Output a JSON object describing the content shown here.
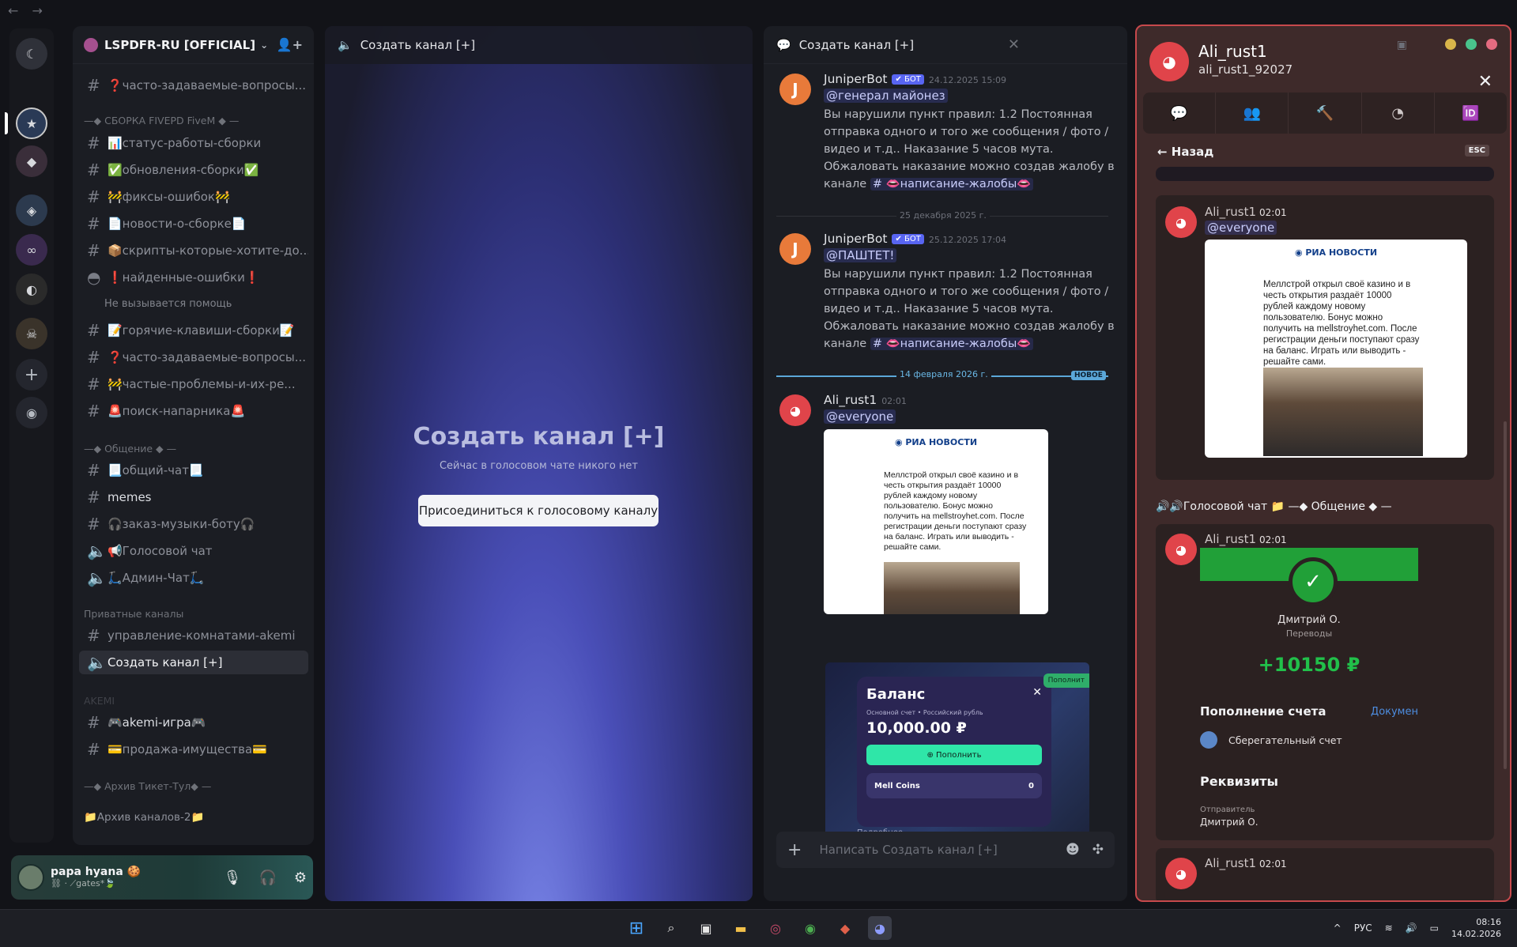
{
  "nav": {
    "back": "←",
    "forward": "→"
  },
  "guild": {
    "name": "LSPDFR-RU [OFFICIAL]",
    "channels": [
      {
        "label": "❓часто-задаваемые-вопросы..."
      },
      {
        "label": "📊статус-работы-сборки"
      },
      {
        "label": "✅обновления-сборки✅"
      },
      {
        "label": "🚧фиксы-ошибок🚧"
      },
      {
        "label": "📄новости-о-сборке📄"
      },
      {
        "label": "📦скрипты-которые-хотите-до..."
      },
      {
        "label": "❗найденные-ошибки❗"
      },
      {
        "label": "📝горячие-клавиши-сборки📝"
      },
      {
        "label": "❓часто-задаваемые-вопросы..."
      },
      {
        "label": "🚧частые-проблемы-и-их-ре..."
      },
      {
        "label": "🚨поиск-напарника🚨"
      },
      {
        "label": "📃общий-чат📃"
      },
      {
        "label": "memes"
      },
      {
        "label": "🎧заказ-музыки-боту🎧"
      },
      {
        "label": "📢Голосовой чат"
      },
      {
        "label": "🛴Админ-Чат🛴"
      },
      {
        "label": "управление-комнатами-akemi"
      },
      {
        "label": "Создать канал [+]"
      },
      {
        "label": "🎮akemi-игра🎮"
      },
      {
        "label": "💳продажа-имущества💳"
      }
    ],
    "categories": {
      "c1": "—◆ СБОРКА FIVEPD FiveM ◆ —",
      "c2": "—◆ Общение ◆ —",
      "c3": "Приватные каналы",
      "c4": "AKEMI",
      "c5": "—◆ Архив Тикет-Тул◆ —",
      "c6": "📁Архив каналов-2📁"
    },
    "thread_note": "Не вызывается помощь"
  },
  "user": {
    "name": "papa hyana 🍪",
    "status": "⛓ · ⟋gates*🍃"
  },
  "voice": {
    "header": "Создать канал [+]",
    "title": "Создать канал [+]",
    "subtitle": "Сейчас в голосовом чате никого нет",
    "join_button": "Присоединиться к голосовому каналу"
  },
  "chat": {
    "header": "Создать канал [+]",
    "messages": [
      {
        "author": "JuniperBot",
        "bot": "✔ БОТ",
        "time": "24.12.2025 15:09",
        "mention": "@генерал майонез",
        "lines": [
          "Вы нарушили пункт правил: 1.2 Постоянная",
          "отправка одного и того же сообщения / фото /",
          "видео и т.д.. Наказание 5 часов мута.",
          "Обжаловать наказание можно создав жалобу в"
        ],
        "tail": "канале",
        "link": "# 👄написание-жалобы👄"
      },
      {
        "author": "JuniperBot",
        "bot": "✔ БОТ",
        "time": "25.12.2025 17:04",
        "mention": "@ПАШТЕТ!",
        "lines": [
          "Вы нарушили пункт правил: 1.2 Постоянная",
          "отправка одного и того же сообщения / фото /",
          "видео и т.д.. Наказание 5 часов мута.",
          "Обжаловать наказание можно создав жалобу в"
        ],
        "tail": "канале",
        "link": "# 👄написание-жалобы👄"
      },
      {
        "author": "Ali_rust1",
        "time": "02:01",
        "mention": "@everyone"
      }
    ],
    "day1": "25 декабря 2025 г.",
    "day2": "14 февраля 2026 г.",
    "new_tag": "НОВОЕ",
    "ria": {
      "logo": "◉ РИА НОВОСТИ",
      "lines": [
        "Меллстрой открыл своё казино и в",
        "честь открытия раздаёт 10000",
        "рублей каждому новому",
        "пользователю. Бонус можно",
        "получить на mellstroyhet.com. После",
        "регистрации деньги поступают сразу",
        "на баланс. Играть или выводить -",
        "решайте сами."
      ]
    },
    "balance": {
      "title": "Баланс",
      "subtitle": "Основной счет • Российский рубль",
      "amount": "10,000.00 ₽",
      "button": "⊕ Пополнить",
      "coins": "Mell Coins",
      "coins_val": "0",
      "more": "Подробнее",
      "topup_tag": "Пополнит"
    },
    "input_placeholder": "Написать Создать канал [+]"
  },
  "profile": {
    "name": "Ali_rust1",
    "handle": "ali_rust1_92027",
    "back": "← Назад",
    "esc": "ESC",
    "msg_author": "Ali_rust1",
    "msg_time": "02:01",
    "mention": "@everyone",
    "vc_label": "🔊🔊Голосовой чат 📁 —◆ Общение ◆ —",
    "sber": {
      "name": "Дмитрий О.",
      "type": "Переводы",
      "amount": "+10150 ₽",
      "h1": "Пополнение счета",
      "docs": "Докумен",
      "account": "Сберегательный счет",
      "h2": "Реквизиты",
      "from": "Отправитель",
      "from_val": "Дмитрий О."
    }
  },
  "taskbar": {
    "lang": "РУС",
    "time": "08:16",
    "date": "14.02.2026"
  },
  "colors": {
    "accent": "#5865f2",
    "danger": "#e0444a",
    "sber": "#21a038"
  }
}
